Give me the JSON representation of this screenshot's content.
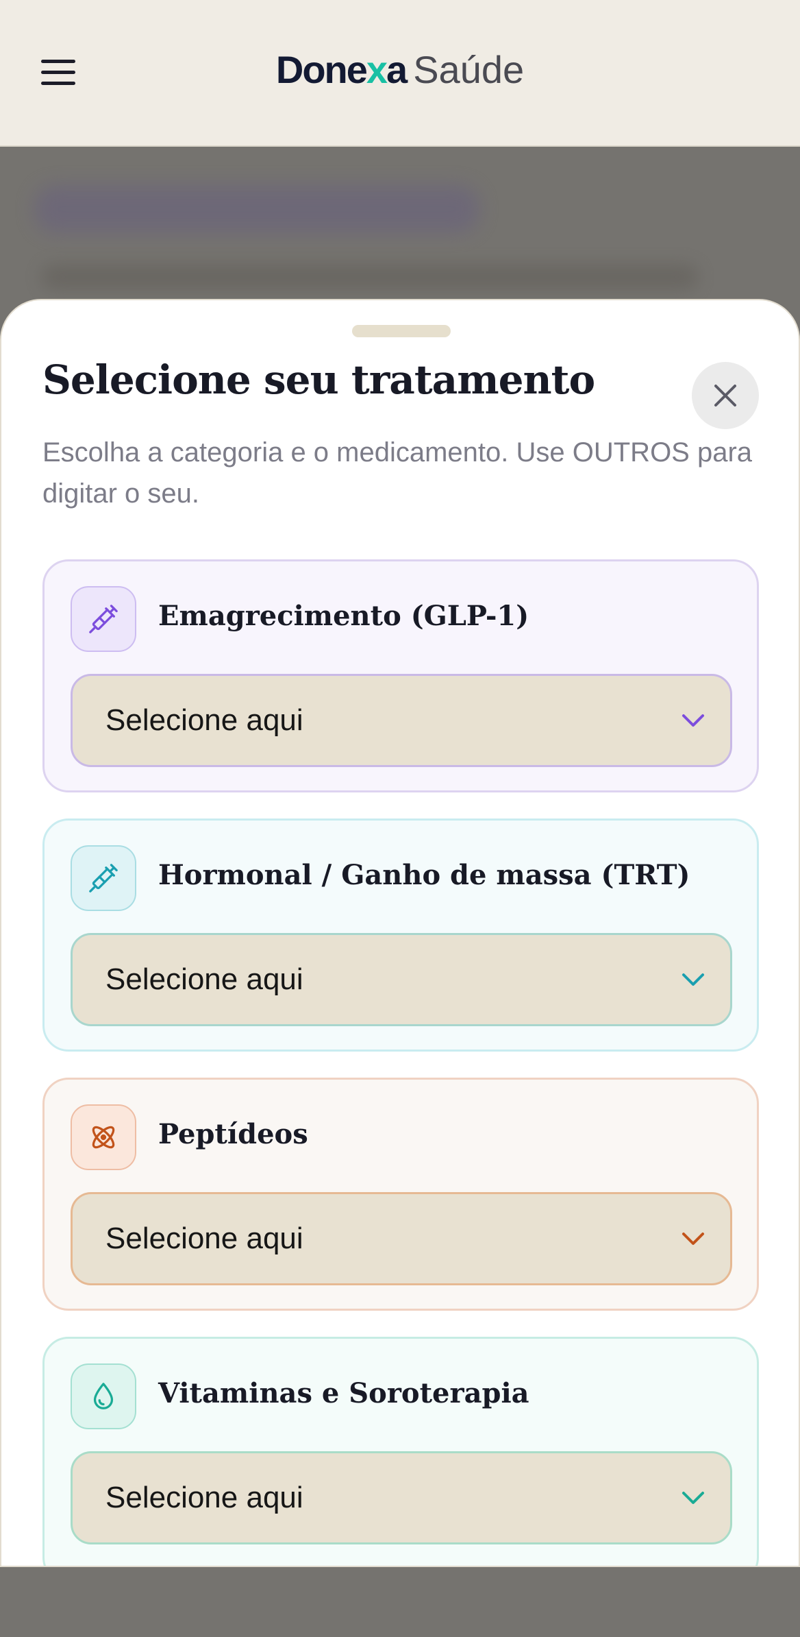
{
  "header": {
    "logo_brand_a": "Done",
    "logo_brand_x": "x",
    "logo_brand_b": "a",
    "logo_sub": "Saúde"
  },
  "sheet": {
    "title": "Selecione seu tratamento",
    "description": "Escolha a categoria e o medicamento. Use OUTROS para digitar o seu.",
    "categories": [
      {
        "title": "Emagrecimento (GLP-1)",
        "select_value": "Selecione aqui",
        "icon": "syringe-icon",
        "accent": "#7c4ddd"
      },
      {
        "title": "Hormonal / Ganho de massa (TRT)",
        "select_value": "Selecione aqui",
        "icon": "syringe-icon",
        "accent": "#1a9fb0"
      },
      {
        "title": "Peptídeos",
        "select_value": "Selecione aqui",
        "icon": "atom-icon",
        "accent": "#c2531a"
      },
      {
        "title": "Vitaminas e Soroterapia",
        "select_value": "Selecione aqui",
        "icon": "droplet-icon",
        "accent": "#1aab95"
      }
    ]
  },
  "colors": {
    "logo_navy": "#131a33",
    "logo_teal": "#19c0a4",
    "overlay": "#75736f",
    "page_bg": "#f0ece4"
  }
}
